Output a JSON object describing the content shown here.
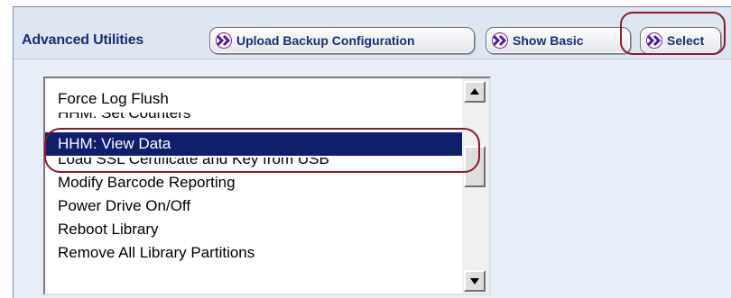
{
  "header": {
    "title": "Advanced Utilities",
    "buttons": {
      "upload_label": "Upload Backup Configuration",
      "show_basic_label": "Show Basic",
      "select_label": "Select"
    }
  },
  "utilities_list": {
    "items": [
      "Force Log Flush",
      "HHM: Set Counters",
      "HHM: View Data",
      "Load SSL Certificate and Key from USB",
      "Modify Barcode Reporting",
      "Power Drive On/Off",
      "Reboot Library",
      "Remove All Library Partitions"
    ],
    "selected": "HHM: View Data"
  },
  "colors": {
    "title_text": "#1b2d74",
    "selection_bg": "#0f1f6b",
    "highlight_ring": "#8c1a2a",
    "panel_bg": "#e8eef8"
  },
  "icons": {
    "button_chevron": "double-chevron-right-icon",
    "scroll_up": "triangle-up-icon",
    "scroll_down": "triangle-down-icon"
  }
}
